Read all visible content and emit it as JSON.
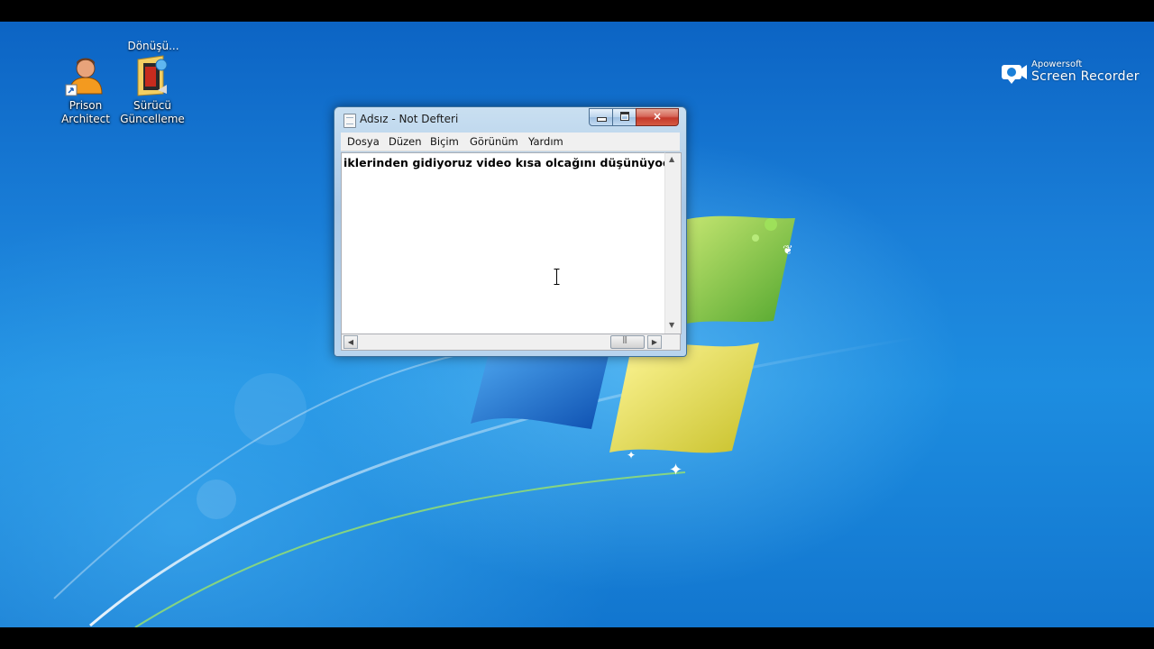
{
  "desktop": {
    "truncated_label": "Dönüşü...",
    "icons": [
      {
        "label_line1": "Prison",
        "label_line2": "Architect",
        "icon": "prison-architect-icon"
      },
      {
        "label_line1": "Sürücü",
        "label_line2": "Güncelleme",
        "icon": "driver-update-folder-icon"
      }
    ]
  },
  "watermark": {
    "brand": "Apowersoft",
    "product": "Screen Recorder",
    "icon": "camera-icon"
  },
  "notepad": {
    "title": "Adsız - Not Defteri",
    "menu": [
      "Dosya",
      "Düzen",
      "Biçim",
      "Görünüm",
      "Yardım"
    ],
    "content": "iklerinden gidiyoruz video kısa olcağını düşünüyodum",
    "controls": {
      "minimize": "minimize-icon",
      "maximize": "maximize-icon",
      "close": "×"
    }
  },
  "colors": {
    "desktop_blue": "#1a7fd8",
    "win_logo_green": "#7ac142",
    "win_logo_yellow": "#f6e33c",
    "win_logo_blue": "#1f6fcf",
    "close_red": "#c4392a"
  }
}
